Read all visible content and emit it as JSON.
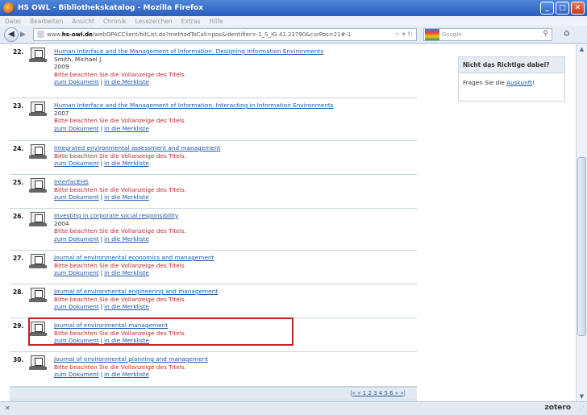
{
  "window": {
    "title": "HS OWL - Bibliothekskatalog - Mozilla Firefox",
    "minimize": "_",
    "maximize": "□",
    "close": "✕"
  },
  "menu": [
    "Datei",
    "Bearbeiten",
    "Ansicht",
    "Chronik",
    "Lesezeichen",
    "Extras",
    "Hilfe"
  ],
  "nav": {
    "url_prefix": "www.",
    "url_host": "hs-owl.de",
    "url_path": "/webOPACClient/hitList.do?methodToCall=pos&identifier=-1_S_IG.41.23790&curPos=21#-1",
    "search_placeholder": "Google"
  },
  "results": [
    {
      "num": "22.",
      "title": "Human Interface and the Management of Information. Designing Information Environments",
      "lines": [
        "Smith, Michael J.",
        "2009"
      ],
      "warn": "Bitte beachten Sie die Vollanzeige des Titels."
    },
    {
      "num": "23.",
      "title": "Human Interface and the Management of Information. Interacting in Information Environments",
      "lines": [
        "2007"
      ],
      "warn": "Bitte beachten Sie die Vollanzeige des Titels."
    },
    {
      "num": "24.",
      "title": "Integrated environmental assessment and management",
      "lines": [],
      "warn": "Bitte beachten Sie die Vollanzeige des Titels."
    },
    {
      "num": "25.",
      "title": "InterfacEHS",
      "lines": [],
      "warn": "Bitte beachten Sie die Vollanzeige des Titels."
    },
    {
      "num": "26.",
      "title": "Investing in corporate social responsibility",
      "lines": [
        "2004"
      ],
      "warn": "Bitte beachten Sie die Vollanzeige des Titels."
    },
    {
      "num": "27.",
      "title": "Journal of environmental economics and management",
      "lines": [],
      "warn": "Bitte beachten Sie die Vollanzeige des Titels."
    },
    {
      "num": "28.",
      "title": "Journal of environmental engineering and management",
      "lines": [],
      "warn": "Bitte beachten Sie die Vollanzeige des Titels."
    },
    {
      "num": "29.",
      "title": "Journal of environmental management",
      "lines": [],
      "warn": "Bitte beachten Sie die Vollanzeige des Titels."
    },
    {
      "num": "30.",
      "title": "Journal of environmental planning and management",
      "lines": [],
      "warn": "Bitte beachten Sie die Vollanzeige des Titels."
    }
  ],
  "links": {
    "doc": "zum Dokument",
    "sep": "|",
    "list": "in die Merkliste"
  },
  "pager": {
    "text": "|« « 1 2 3 4 5 6 » »|"
  },
  "sidebox": {
    "head": "Nicht das Richtige dabei?",
    "body_prefix": "Fragen Sie die ",
    "link": "Auskunft",
    "body_suffix": "!"
  },
  "status": {
    "close": "✕",
    "zotero": "zotero"
  }
}
